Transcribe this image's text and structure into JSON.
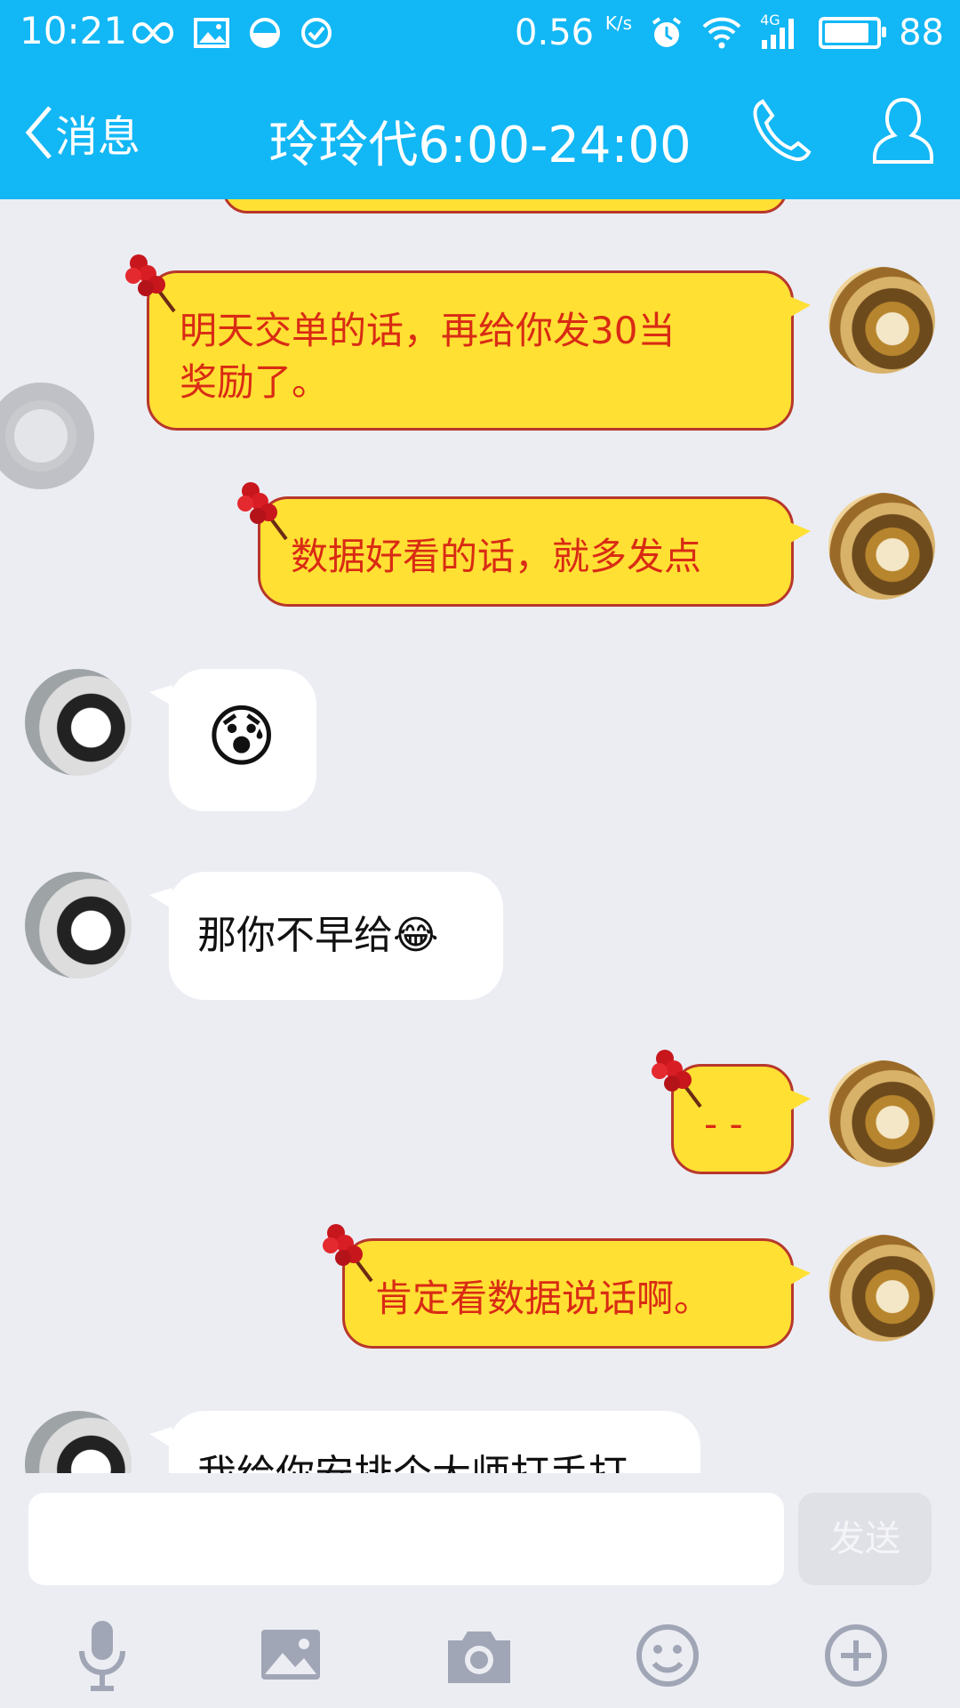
{
  "status_bar": {
    "time": "10:21",
    "net_speed": "0.56",
    "net_unit": "K/s",
    "network": "4G",
    "battery": "88",
    "battery_level_pct": 88
  },
  "header": {
    "back_label": "消息",
    "title": "玲玲代6:00-24:00"
  },
  "messages": [
    {
      "sender": "self",
      "text_line1": "明天交单的话，再给你发30当",
      "text_line2": "奖励了。"
    },
    {
      "sender": "self",
      "text": "数据好看的话，就多发点"
    },
    {
      "sender": "other",
      "emoji": "😰"
    },
    {
      "sender": "other",
      "text": "那你不早给",
      "emoji": "😂"
    },
    {
      "sender": "self",
      "text": "- -"
    },
    {
      "sender": "self",
      "text": "肯定看数据说话啊。"
    },
    {
      "sender": "other",
      "text": "我给你安排个大师打手打"
    }
  ],
  "composer": {
    "input_value": "",
    "send_label": "发送"
  },
  "toolbar_icons": [
    "microphone-icon",
    "image-icon",
    "camera-icon",
    "emoji-icon",
    "plus-icon"
  ]
}
